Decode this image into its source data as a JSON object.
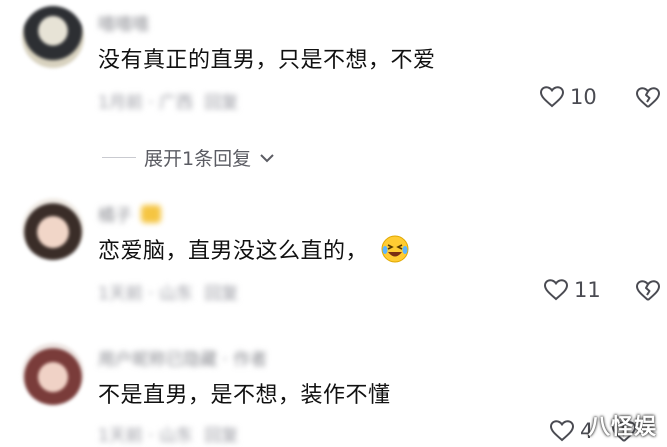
{
  "comments": [
    {
      "username": "嘻嘻嘻",
      "text": "没有真正的直男，只是不想，不爱",
      "meta": "1月前 · 广西",
      "reply_label": "回复",
      "likes": "10"
    },
    {
      "username": "橘子",
      "text": "恋爱脑，直男没这么直的，",
      "emoji": "laughing-crying-emoji",
      "meta": "1天前 · 山东",
      "reply_label": "回复",
      "likes": "11"
    },
    {
      "username": "用户昵称已隐藏 · 作者",
      "text": "不是直男，是不想，装作不懂",
      "meta": "1天前 · 山东",
      "reply_label": "回复",
      "likes": "4"
    }
  ],
  "expand_replies": "展开1条回复",
  "watermark": "八怪娱",
  "colors": {
    "text": "#111111",
    "muted": "#9a9ba3",
    "icon": "#4a4b52"
  }
}
